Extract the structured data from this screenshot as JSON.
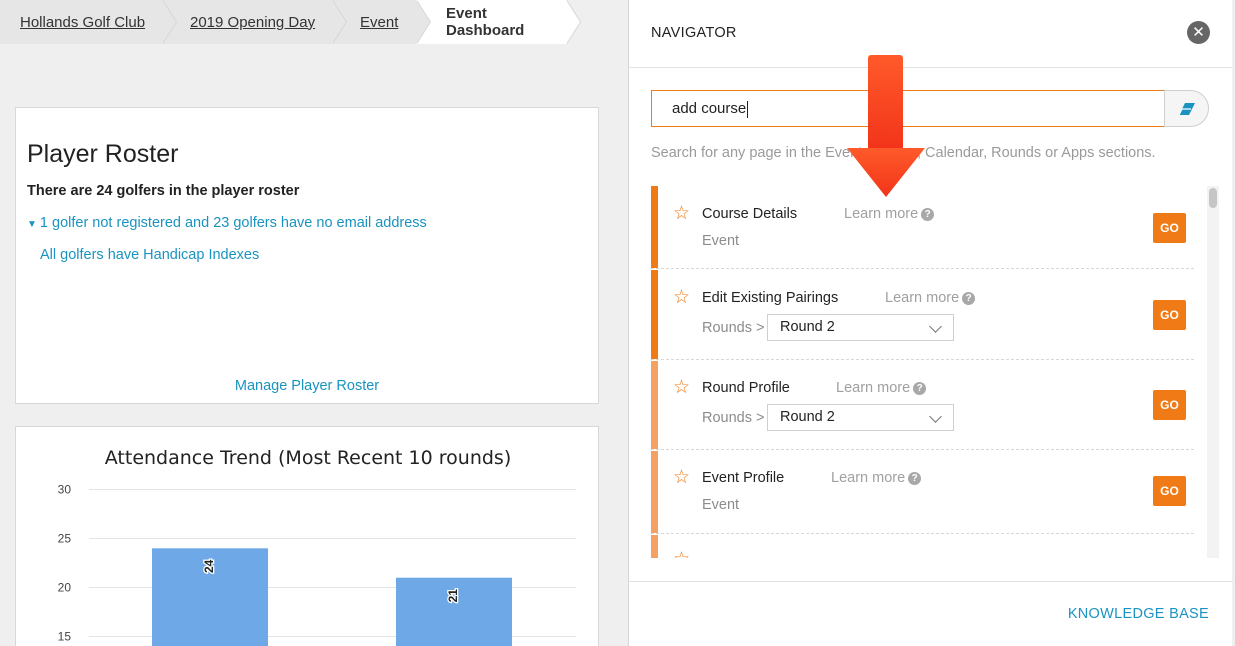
{
  "breadcrumb": {
    "items": [
      "Hollands Golf Club",
      "2019 Opening Day",
      "Event"
    ],
    "current": "Event Dashboard"
  },
  "roster": {
    "title": "Player Roster",
    "summary": "There are 24 golfers in the player roster",
    "warning": "1 golfer not registered and 23 golfers have no email address",
    "handicap": "All golfers have Handicap Indexes",
    "manage_link": "Manage Player Roster"
  },
  "attendance": {
    "title": "Attendance Trend (Most Recent 10 rounds)"
  },
  "chart_data": {
    "type": "bar",
    "title": "Attendance Trend (Most Recent 10 rounds)",
    "y_ticks": [
      15,
      20,
      25,
      30
    ],
    "ylim": [
      15,
      30
    ],
    "values": [
      24,
      21
    ],
    "data_labels": [
      "24",
      "21"
    ],
    "bar_color": "#6fa8e6",
    "grid": true
  },
  "navigator": {
    "title": "NAVIGATOR",
    "close_icon": "close-icon",
    "search_value": "add course",
    "hint": "Search for any page in the Event, Golfers, Calendar, Rounds or Apps sections.",
    "knowledge_base": "KNOWLEDGE BASE",
    "accent_color": "#f07a16",
    "results": [
      {
        "title": "Course Details",
        "learn_more": "Learn more",
        "section": "Event",
        "go": "GO"
      },
      {
        "title": "Edit Existing Pairings",
        "learn_more": "Learn more",
        "section": "Rounds >",
        "select_value": "Round 2",
        "go": "GO"
      },
      {
        "title": "Round Profile",
        "learn_more": "Learn more",
        "section": "Rounds >",
        "select_value": "Round 2",
        "go": "GO"
      },
      {
        "title": "Event Profile",
        "learn_more": "Learn more",
        "section": "Event",
        "go": "GO"
      }
    ]
  }
}
